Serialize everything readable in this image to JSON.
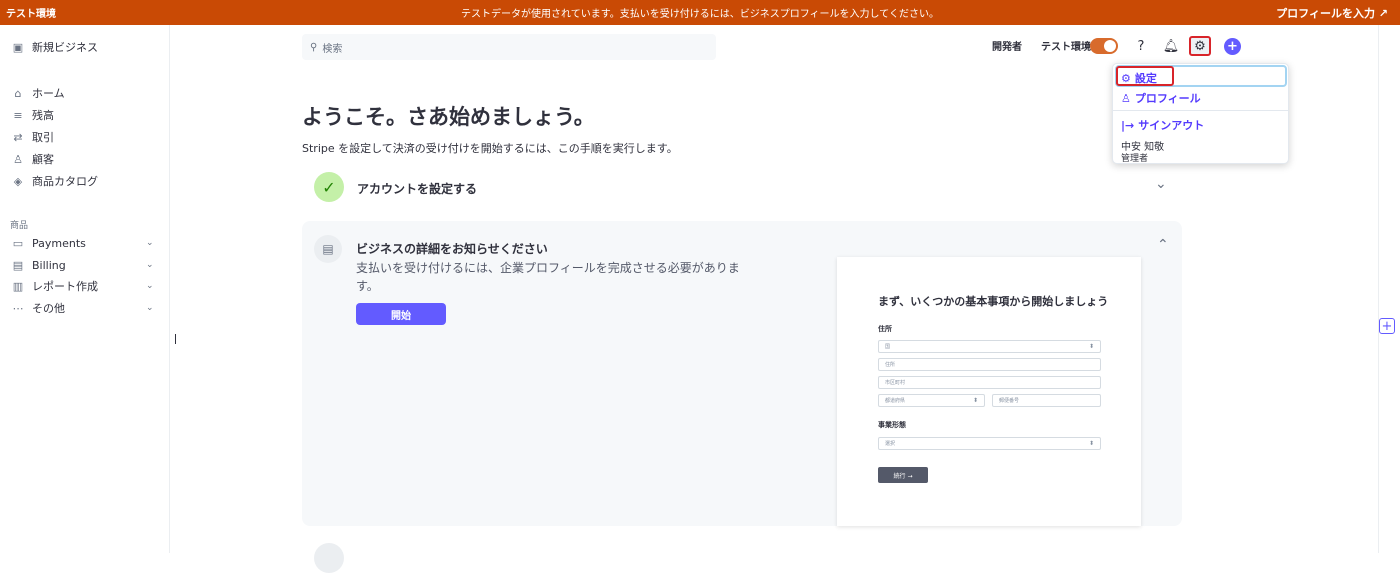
{
  "banner": {
    "env_label": "テスト環境",
    "message": "テストデータが使用されています。支払いを受け付けるには、ビジネスプロフィールを入力してください。",
    "link_label": "プロフィールを入力 ↗"
  },
  "sidebar": {
    "account_name": "新規ビジネス",
    "account_icon": "store-icon",
    "items": [
      {
        "label": "ホーム",
        "icon": "home-icon"
      },
      {
        "label": "残高",
        "icon": "balance-icon"
      },
      {
        "label": "取引",
        "icon": "transactions-icon"
      },
      {
        "label": "顧客",
        "icon": "customers-icon"
      },
      {
        "label": "商品カタログ",
        "icon": "product-catalog-icon"
      }
    ],
    "section_label": "商品",
    "product_items": [
      {
        "label": "Payments",
        "icon": "payments-icon"
      },
      {
        "label": "Billing",
        "icon": "billing-icon"
      },
      {
        "label": "レポート作成",
        "icon": "reports-icon"
      },
      {
        "label": "その他",
        "icon": "more-icon"
      }
    ]
  },
  "search": {
    "placeholder": "検索",
    "icon": "search-icon"
  },
  "topbar": {
    "developer_label": "開発者",
    "test_env_label": "テスト環境",
    "test_env_on": true,
    "toggle_color": "#d86b2c",
    "accent_color": "#635bff"
  },
  "settings_menu": {
    "settings_label": "設定",
    "profile_label": "プロフィール",
    "signout_label": "サインアウト",
    "user_name": "中安 知敬",
    "user_role": "管理者"
  },
  "main": {
    "title": "ようこそ。さあ始めましょう。",
    "subtitle": "Stripe を設定して決済の受け付けを開始するには、この手順を実行します。",
    "step1_label": "アカウントを設定する",
    "step2_title": "ビジネスの詳細をお知らせください",
    "step2_desc": "支払いを受け付けるには、企業プロフィールを完成させる必要があります。",
    "start_button": "開始"
  },
  "preview": {
    "title": "まず、いくつかの基本事項から開始しましょう",
    "address_label": "住所",
    "country_field": "国",
    "address_field": "住所",
    "city_field": "市区町村",
    "prefecture_field": "都道府県",
    "postal_field": "郵便番号",
    "business_type_label": "事業形態",
    "business_type_field": "選択",
    "next_button": "続行 →"
  }
}
